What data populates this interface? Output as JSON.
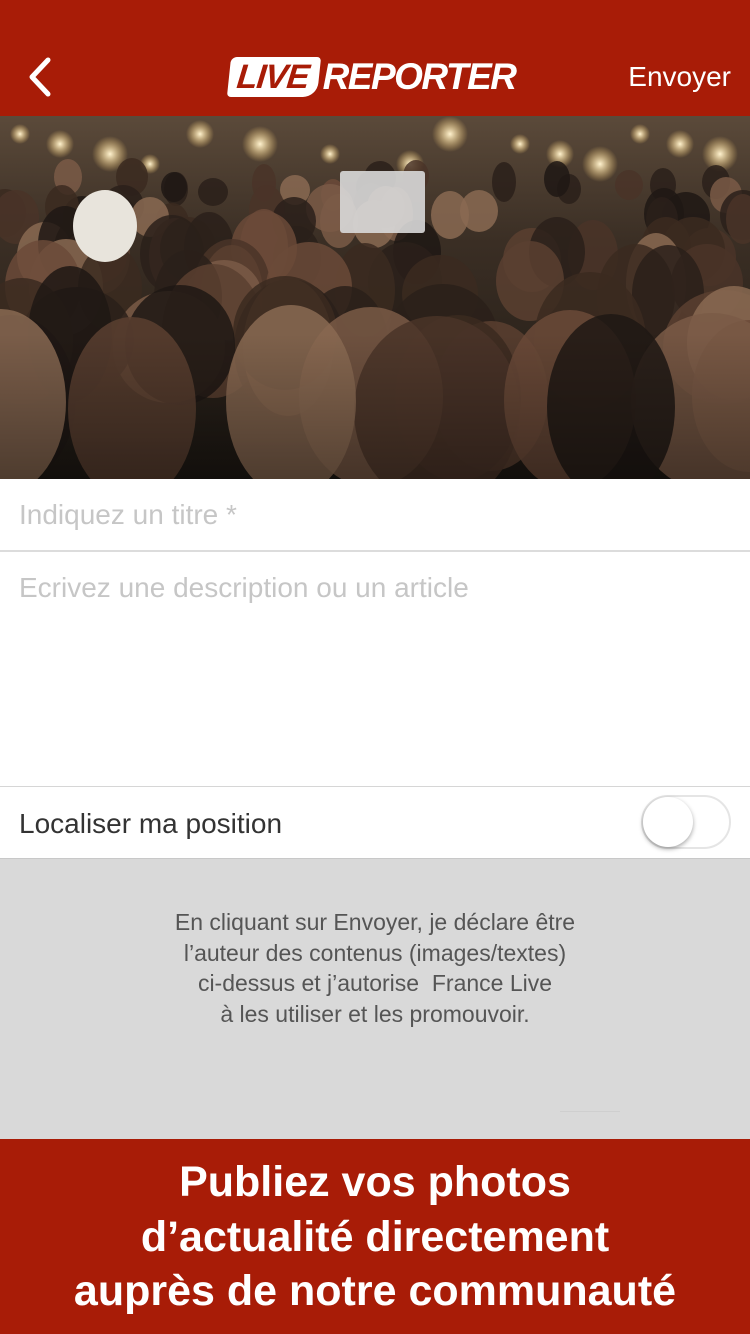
{
  "header": {
    "back_icon": "chevron-left-icon",
    "logo_live": "LIVE",
    "logo_reporter": "REPORTER",
    "send_label": "Envoyer",
    "accent_color": "#a81c07"
  },
  "photo": {
    "subject": "crowd-photo"
  },
  "form": {
    "title_placeholder": "Indiquez un titre *",
    "description_placeholder": "Ecrivez une description ou un article",
    "location_label": "Localiser ma position",
    "location_enabled": false
  },
  "legal": {
    "lines": [
      "En cliquant sur Envoyer, je déclare être",
      "l’auteur des contenus (images/textes)",
      "ci-dessus et j’autorise  France Live",
      "à les utiliser et les promouvoir."
    ]
  },
  "banner": {
    "lines": [
      "Publiez vos photos",
      "d’actualité directement",
      "auprès de notre communauté"
    ]
  }
}
